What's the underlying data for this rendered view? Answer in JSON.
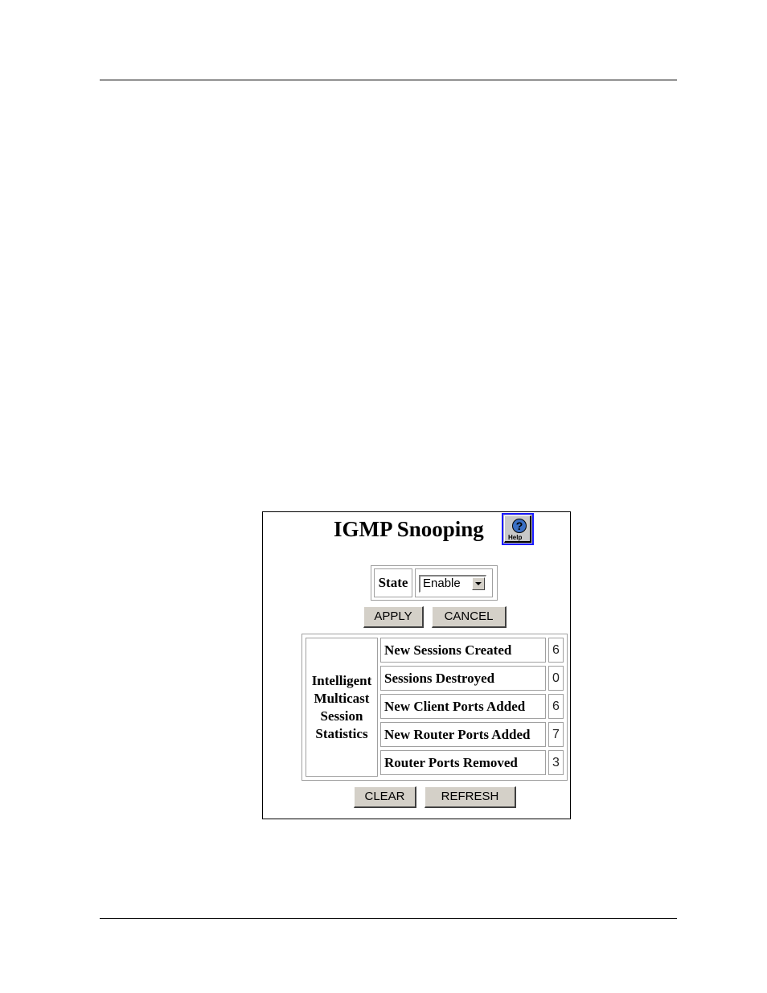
{
  "page": {
    "title": "IGMP Snooping",
    "help_button": {
      "icon": "help-icon",
      "label": "Help"
    },
    "state": {
      "label": "State",
      "selected": "Enable"
    },
    "buttons": {
      "apply": "APPLY",
      "cancel": "CANCEL",
      "clear": "CLEAR",
      "refresh": "REFRESH"
    },
    "statistics": {
      "group_label": "Intelligent Multicast Session Statistics",
      "rows": [
        {
          "label": "New Sessions Created",
          "value": "6"
        },
        {
          "label": "Sessions Destroyed",
          "value": "0"
        },
        {
          "label": "New Client Ports Added",
          "value": "6"
        },
        {
          "label": "New Router Ports Added",
          "value": "7"
        },
        {
          "label": "Router Ports Removed",
          "value": "3"
        }
      ]
    }
  }
}
